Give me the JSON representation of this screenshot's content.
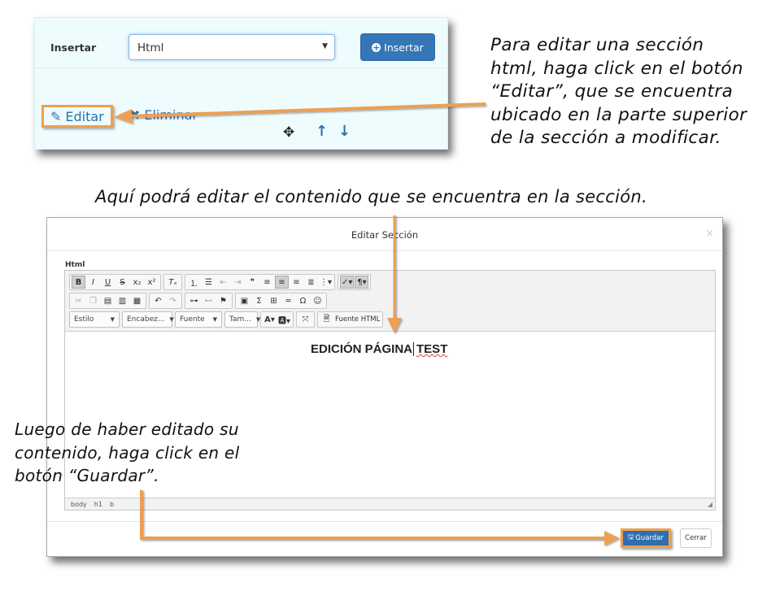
{
  "panel": {
    "insert_label": "Insertar",
    "select_value": "Html",
    "insert_button": "Insertar",
    "edit_button": "Editar",
    "delete_button": "Eliminar"
  },
  "notes": {
    "top_right": "Para editar una sección html, haga click en el botón “Editar”, que se encuentra ubicado en la parte superior de la sección a modificar.",
    "middle": "Aquí podrá editar el contenido que se encuentra en la sección.",
    "bottom_left": "Luego de haber editado su contenido, haga click en el botón “Guardar”."
  },
  "modal": {
    "title": "Editar Sección",
    "close": "×",
    "field_label": "Html",
    "toolbar": {
      "style_combo": "Estilo",
      "heading_combo": "Encabez...",
      "font_combo": "Fuente",
      "size_combo": "Tam...",
      "source_button": "Fuente HTML"
    },
    "content": {
      "heading_part1": "EDICIÓN PÁGINA",
      "heading_part2": "TEST"
    },
    "statusbar": [
      "body",
      "h1",
      "b"
    ],
    "save_button": "Guardar",
    "close_button": "Cerrar"
  },
  "colors": {
    "accent_orange": "#ED9F52",
    "primary_blue": "#3476B6",
    "panel_bg": "#EEFCFE"
  }
}
